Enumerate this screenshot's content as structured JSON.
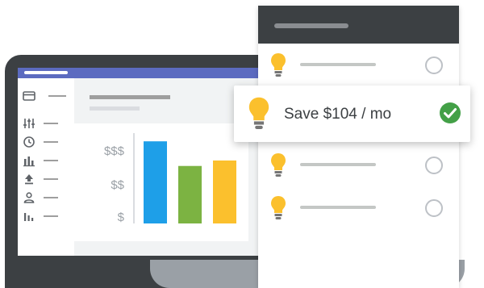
{
  "chart_data": {
    "type": "bar",
    "y_tick_labels": [
      "$$$",
      "$$",
      "$"
    ],
    "series": [
      {
        "color": "#1e9fe8",
        "value": 3
      },
      {
        "color": "#7cb342",
        "value": 2.1
      },
      {
        "color": "#fbc02d",
        "value": 2.3
      }
    ],
    "ylim": [
      0,
      3.3
    ]
  },
  "sidebar": {
    "icons": [
      "card-icon",
      "filters-icon",
      "clock-icon",
      "bar-chart-icon",
      "upload-icon",
      "person-icon",
      "stats-icon"
    ]
  },
  "savings_card": {
    "text": "Save $104 / mo",
    "status_icon": "check-circle-icon",
    "status_color": "#43a047"
  },
  "phone": {
    "items": [
      {
        "icon": "lightbulb-icon",
        "checked": false
      },
      {
        "icon": "lightbulb-icon",
        "checked": false
      },
      {
        "icon": "lightbulb-icon",
        "checked": false
      }
    ]
  },
  "colors": {
    "accent_bar": "#5c6bc0",
    "device_dark": "#3c4043",
    "bulb_yellow": "#fbc02d"
  }
}
